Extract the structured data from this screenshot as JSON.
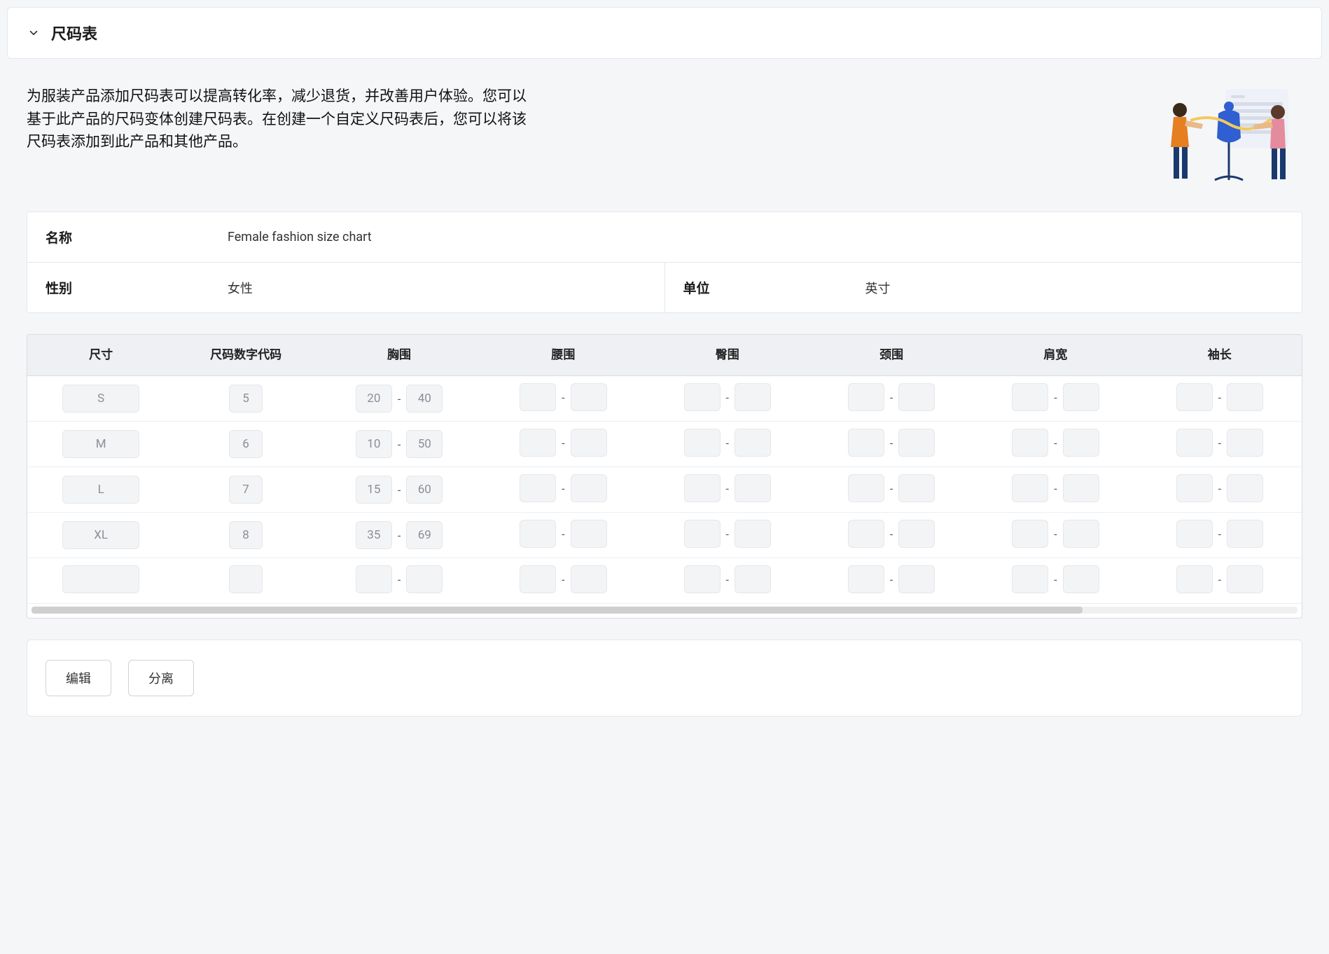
{
  "header": {
    "title": "尺码表"
  },
  "intro": "为服装产品添加尺码表可以提高转化率，减少退货，并改善用户体验。您可以基于此产品的尺码变体创建尺码表。在创建一个自定义尺码表后，您可以将该尺码表添加到此产品和其他产品。",
  "meta": {
    "name_label": "名称",
    "name_value": "Female fashion size chart",
    "gender_label": "性别",
    "gender_value": "女性",
    "unit_label": "单位",
    "unit_value": "英寸"
  },
  "columns": [
    "尺寸",
    "尺码数字代码",
    "胸围",
    "腰围",
    "臀围",
    "颈围",
    "肩宽",
    "袖长"
  ],
  "rows": [
    {
      "size": "S",
      "code": "5",
      "bust": [
        "20",
        "40"
      ],
      "waist": [
        "",
        ""
      ],
      "hip": [
        "",
        ""
      ],
      "neck": [
        "",
        ""
      ],
      "shoulder": [
        "",
        ""
      ],
      "sleeve": [
        "",
        ""
      ]
    },
    {
      "size": "M",
      "code": "6",
      "bust": [
        "10",
        "50"
      ],
      "waist": [
        "",
        ""
      ],
      "hip": [
        "",
        ""
      ],
      "neck": [
        "",
        ""
      ],
      "shoulder": [
        "",
        ""
      ],
      "sleeve": [
        "",
        ""
      ]
    },
    {
      "size": "L",
      "code": "7",
      "bust": [
        "15",
        "60"
      ],
      "waist": [
        "",
        ""
      ],
      "hip": [
        "",
        ""
      ],
      "neck": [
        "",
        ""
      ],
      "shoulder": [
        "",
        ""
      ],
      "sleeve": [
        "",
        ""
      ]
    },
    {
      "size": "XL",
      "code": "8",
      "bust": [
        "35",
        "69"
      ],
      "waist": [
        "",
        ""
      ],
      "hip": [
        "",
        ""
      ],
      "neck": [
        "",
        ""
      ],
      "shoulder": [
        "",
        ""
      ],
      "sleeve": [
        "",
        ""
      ]
    },
    {
      "size": "",
      "code": "",
      "bust": [
        "",
        ""
      ],
      "waist": [
        "",
        ""
      ],
      "hip": [
        "",
        ""
      ],
      "neck": [
        "",
        ""
      ],
      "shoulder": [
        "",
        ""
      ],
      "sleeve": [
        "",
        ""
      ]
    }
  ],
  "actions": {
    "edit": "编辑",
    "detach": "分离"
  }
}
